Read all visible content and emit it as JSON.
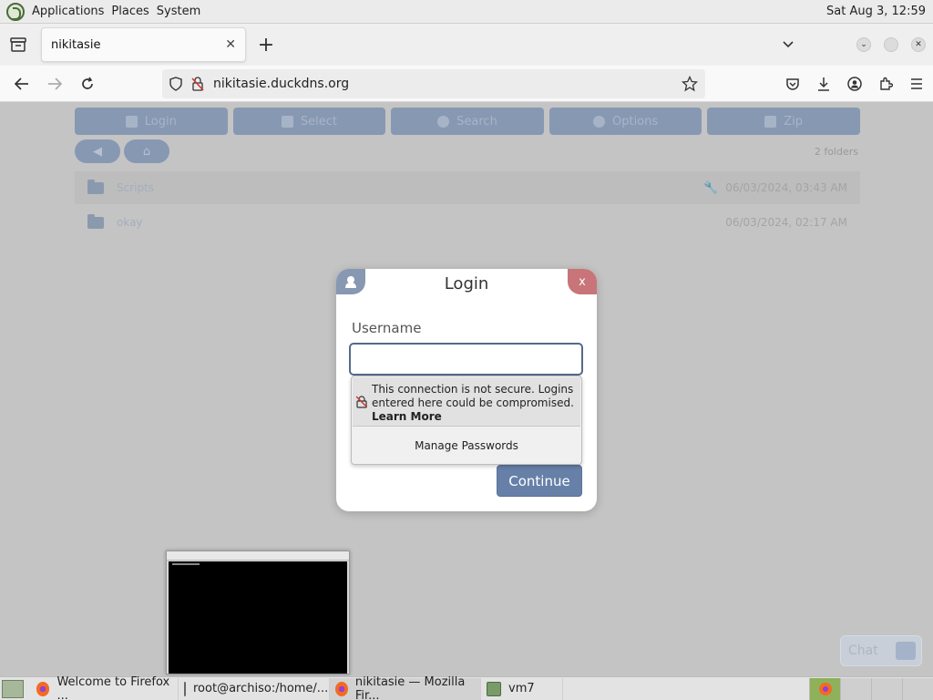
{
  "top_panel": {
    "menus": [
      "Applications",
      "Places",
      "System"
    ],
    "clock": "Sat Aug  3, 12:59"
  },
  "browser": {
    "tab_title": "nikitasie",
    "url": "nikitasie.duckdns.org"
  },
  "page": {
    "toolbar": [
      "Login",
      "Select",
      "Search",
      "Options",
      "Zip"
    ],
    "folders_count": "2 folders",
    "files": [
      {
        "name": "Scripts",
        "date": "06/03/2024, 03:43 AM"
      },
      {
        "name": "okay",
        "date": "06/03/2024, 02:17 AM"
      }
    ]
  },
  "dialog": {
    "title": "Login",
    "close_label": "x",
    "username_label": "Username",
    "username_value": "",
    "continue_label": "Continue",
    "insecure": {
      "message": "This connection is not secure. Logins entered here could be compromised.",
      "learn_more": "Learn More",
      "manage_passwords": "Manage Passwords"
    }
  },
  "chat": {
    "label": "Chat"
  },
  "taskbar": {
    "tasks": [
      "Welcome to Firefox ...",
      "root@archiso:/home/...",
      "nikitasie — Mozilla Fir...",
      "vm7"
    ]
  },
  "colors": {
    "accent": "#6680a8",
    "close": "#c87478",
    "dim_overlay": "#c4c4c4"
  }
}
